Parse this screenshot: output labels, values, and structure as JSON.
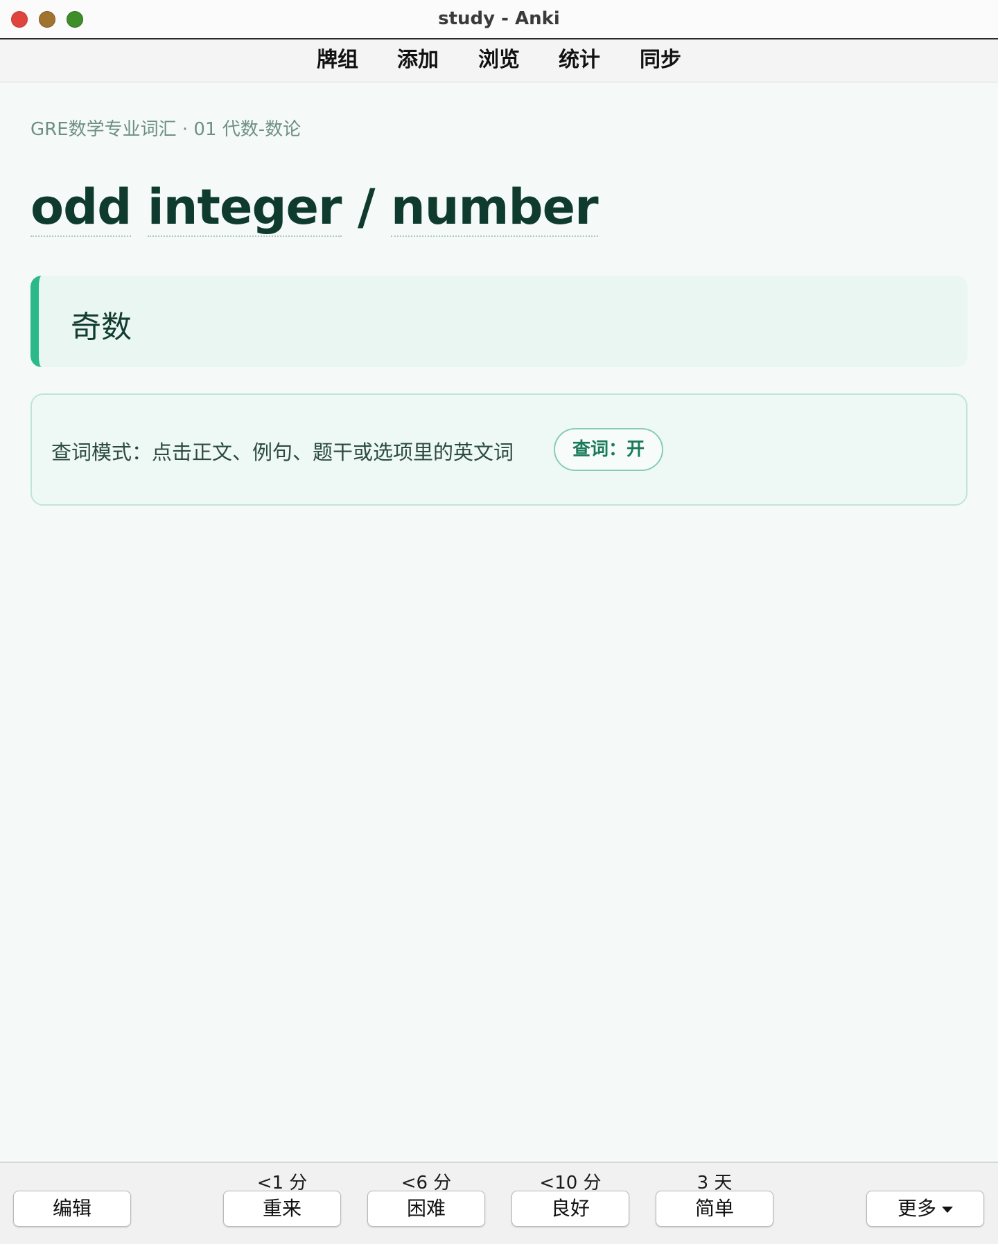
{
  "window": {
    "title": "study - Anki"
  },
  "toolbar": {
    "items": [
      "牌组",
      "添加",
      "浏览",
      "统计",
      "同步"
    ]
  },
  "card": {
    "breadcrumb": "GRE数学专业词汇 · 01 代数-数论",
    "headword": {
      "words": [
        "odd",
        "integer",
        "/",
        "number"
      ]
    },
    "meaning": "奇数",
    "lookup": {
      "text": "查词模式：点击正文、例句、题干或选项里的英文词",
      "toggle_label": "查词：开"
    }
  },
  "answer_bar": {
    "edit_label": "编辑",
    "more_label": "更多",
    "buttons": [
      {
        "interval": "<1 分",
        "label": "重来"
      },
      {
        "interval": "<6 分",
        "label": "困难"
      },
      {
        "interval": "<10 分",
        "label": "良好"
      },
      {
        "interval": "3 天",
        "label": "简单"
      }
    ]
  },
  "colors": {
    "accent": "#2bb98a",
    "headword": "#0f3b2f",
    "background": "#f5faf8"
  }
}
